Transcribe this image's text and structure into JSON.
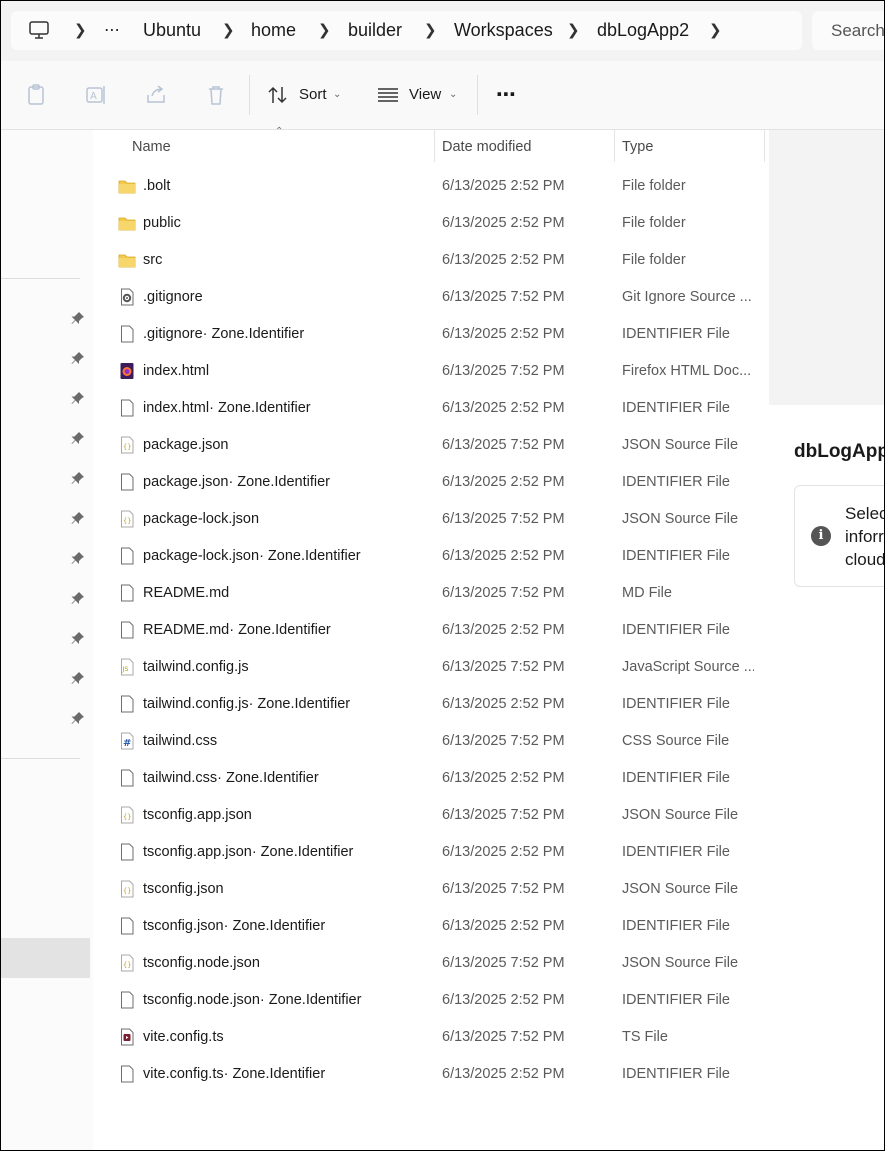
{
  "breadcrumb": [
    "Ubuntu",
    "home",
    "builder",
    "Workspaces",
    "dbLogApp2"
  ],
  "search_placeholder": "Search",
  "toolbar": {
    "sort_label": "Sort",
    "view_label": "View"
  },
  "columns": {
    "name": "Name",
    "date": "Date modified",
    "type": "Type"
  },
  "files": [
    {
      "name": ".bolt",
      "date": "6/13/2025 2:52 PM",
      "type": "File folder",
      "icon": "folder-icon"
    },
    {
      "name": "public",
      "date": "6/13/2025 2:52 PM",
      "type": "File folder",
      "icon": "folder-icon"
    },
    {
      "name": "src",
      "date": "6/13/2025 2:52 PM",
      "type": "File folder",
      "icon": "folder-icon"
    },
    {
      "name": ".gitignore",
      "date": "6/13/2025 7:52 PM",
      "type": "Git Ignore Source ...",
      "icon": "gear-file-icon"
    },
    {
      "name": ".gitignore· Zone.Identifier",
      "date": "6/13/2025 2:52 PM",
      "type": "IDENTIFIER File",
      "icon": "blank-file-icon"
    },
    {
      "name": "index.html",
      "date": "6/13/2025 7:52 PM",
      "type": "Firefox HTML Doc...",
      "icon": "firefox-file-icon"
    },
    {
      "name": "index.html· Zone.Identifier",
      "date": "6/13/2025 2:52 PM",
      "type": "IDENTIFIER File",
      "icon": "blank-file-icon"
    },
    {
      "name": "package.json",
      "date": "6/13/2025 7:52 PM",
      "type": "JSON Source File",
      "icon": "json-file-icon"
    },
    {
      "name": "package.json· Zone.Identifier",
      "date": "6/13/2025 2:52 PM",
      "type": "IDENTIFIER File",
      "icon": "blank-file-icon"
    },
    {
      "name": "package-lock.json",
      "date": "6/13/2025 7:52 PM",
      "type": "JSON Source File",
      "icon": "json-file-icon"
    },
    {
      "name": "package-lock.json· Zone.Identifier",
      "date": "6/13/2025 2:52 PM",
      "type": "IDENTIFIER File",
      "icon": "blank-file-icon"
    },
    {
      "name": "README.md",
      "date": "6/13/2025 7:52 PM",
      "type": "MD File",
      "icon": "blank-file-icon"
    },
    {
      "name": "README.md· Zone.Identifier",
      "date": "6/13/2025 2:52 PM",
      "type": "IDENTIFIER File",
      "icon": "blank-file-icon"
    },
    {
      "name": "tailwind.config.js",
      "date": "6/13/2025 7:52 PM",
      "type": "JavaScript Source ...",
      "icon": "js-file-icon"
    },
    {
      "name": "tailwind.config.js· Zone.Identifier",
      "date": "6/13/2025 2:52 PM",
      "type": "IDENTIFIER File",
      "icon": "blank-file-icon"
    },
    {
      "name": "tailwind.css",
      "date": "6/13/2025 7:52 PM",
      "type": "CSS Source File",
      "icon": "css-file-icon"
    },
    {
      "name": "tailwind.css· Zone.Identifier",
      "date": "6/13/2025 2:52 PM",
      "type": "IDENTIFIER File",
      "icon": "blank-file-icon"
    },
    {
      "name": "tsconfig.app.json",
      "date": "6/13/2025 7:52 PM",
      "type": "JSON Source File",
      "icon": "json-file-icon"
    },
    {
      "name": "tsconfig.app.json· Zone.Identifier",
      "date": "6/13/2025 2:52 PM",
      "type": "IDENTIFIER File",
      "icon": "blank-file-icon"
    },
    {
      "name": "tsconfig.json",
      "date": "6/13/2025 7:52 PM",
      "type": "JSON Source File",
      "icon": "json-file-icon"
    },
    {
      "name": "tsconfig.json· Zone.Identifier",
      "date": "6/13/2025 2:52 PM",
      "type": "IDENTIFIER File",
      "icon": "blank-file-icon"
    },
    {
      "name": "tsconfig.node.json",
      "date": "6/13/2025 7:52 PM",
      "type": "JSON Source File",
      "icon": "json-file-icon"
    },
    {
      "name": "tsconfig.node.json· Zone.Identifier",
      "date": "6/13/2025 2:52 PM",
      "type": "IDENTIFIER File",
      "icon": "blank-file-icon"
    },
    {
      "name": "vite.config.ts",
      "date": "6/13/2025 7:52 PM",
      "type": "TS File",
      "icon": "ts-file-icon"
    },
    {
      "name": "vite.config.ts· Zone.Identifier",
      "date": "6/13/2025 2:52 PM",
      "type": "IDENTIFIER File",
      "icon": "blank-file-icon"
    }
  ],
  "details": {
    "title": "dbLogApp",
    "info_lines": [
      "Selec",
      "inforr",
      "cloud"
    ]
  }
}
